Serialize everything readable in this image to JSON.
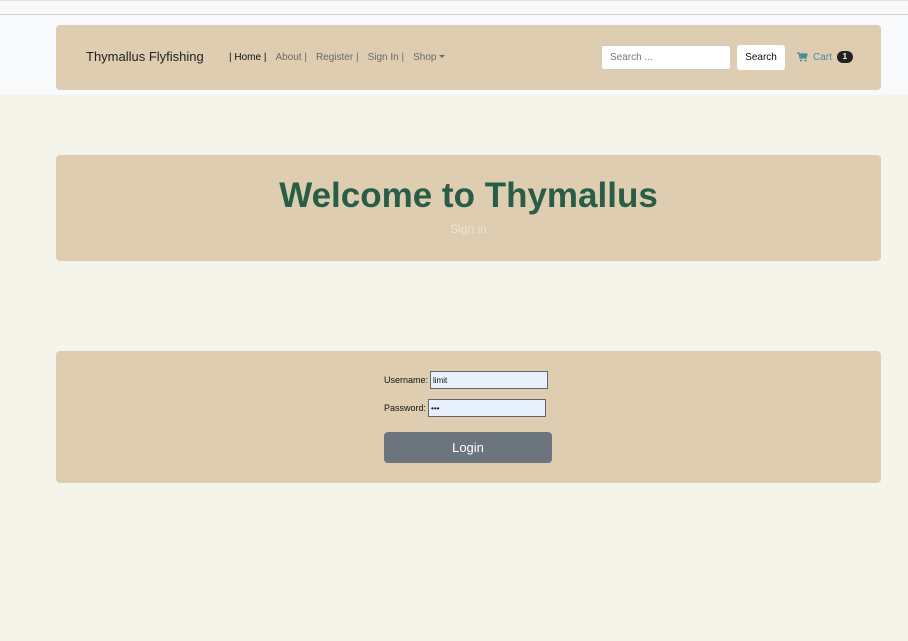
{
  "nav": {
    "brand": "Thymallus Flyfishing",
    "links": [
      {
        "label": "| Home |"
      },
      {
        "label": "About |"
      },
      {
        "label": "Register |"
      },
      {
        "label": "Sign In |"
      },
      {
        "label": "Shop"
      }
    ],
    "search_placeholder": "Search ...",
    "search_button": "Search",
    "cart_label": "Cart",
    "cart_count": "1"
  },
  "hero": {
    "title": "Welcome to Thymallus",
    "subtitle": "Sign in"
  },
  "login": {
    "username_label": "Username:",
    "username_value": "limit",
    "password_label": "Password:",
    "password_value": "abc",
    "button": "Login"
  },
  "colors": {
    "background": "#f5f4ea",
    "panel": "#decdb0",
    "title": "#285e46",
    "button": "#6c757d",
    "cart_link": "#4a8aa0"
  },
  "icons": {
    "cart": "shopping-cart-icon",
    "dropdown": "caret-down-icon"
  }
}
